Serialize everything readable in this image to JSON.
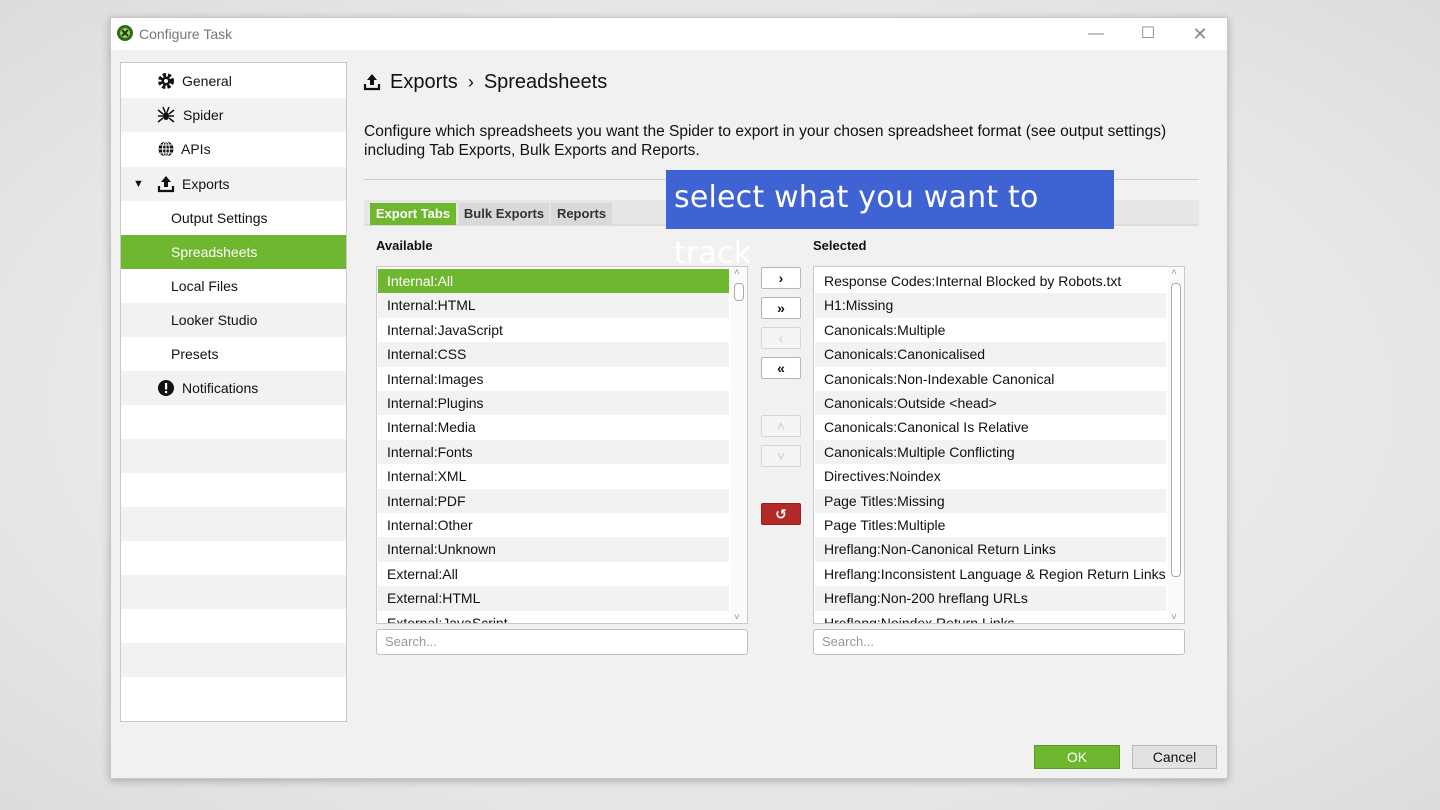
{
  "window": {
    "title": "Configure Task",
    "minimize": "—",
    "maximize": "☐",
    "close": "✕"
  },
  "sidebar": {
    "items": [
      {
        "label": "General",
        "icon": "gear-icon"
      },
      {
        "label": "Spider",
        "icon": "spider-icon"
      },
      {
        "label": "APIs",
        "icon": "globe-icon"
      },
      {
        "label": "Exports",
        "icon": "upload-icon",
        "expand": "▼"
      },
      {
        "label": "Output Settings"
      },
      {
        "label": "Spreadsheets"
      },
      {
        "label": "Local Files"
      },
      {
        "label": "Looker Studio"
      },
      {
        "label": "Presets"
      },
      {
        "label": "Notifications",
        "icon": "alert-icon"
      }
    ]
  },
  "breadcrumb": {
    "part1": "Exports",
    "separator": "›",
    "part2": "Spreadsheets"
  },
  "description": "Configure which spreadsheets you want the Spider to export in your chosen spreadsheet format (see output settings) including Tab Exports, Bulk Exports and Reports.",
  "tabs": [
    "Export Tabs",
    "Bulk Exports",
    "Reports"
  ],
  "available": {
    "label": "Available",
    "items": [
      "Internal:All",
      "Internal:HTML",
      "Internal:JavaScript",
      "Internal:CSS",
      "Internal:Images",
      "Internal:Plugins",
      "Internal:Media",
      "Internal:Fonts",
      "Internal:XML",
      "Internal:PDF",
      "Internal:Other",
      "Internal:Unknown",
      "External:All",
      "External:HTML",
      "External:JavaScript"
    ],
    "search_placeholder": "Search..."
  },
  "selected": {
    "label": "Selected",
    "items": [
      "Response Codes:Internal Blocked by Robots.txt",
      "H1:Missing",
      "Canonicals:Multiple",
      "Canonicals:Canonicalised",
      "Canonicals:Non-Indexable Canonical",
      "Canonicals:Outside <head>",
      "Canonicals:Canonical Is Relative",
      "Canonicals:Multiple Conflicting",
      "Directives:Noindex",
      "Page Titles:Missing",
      "Page Titles:Multiple",
      "Hreflang:Non-Canonical Return Links",
      "Hreflang:Inconsistent Language & Region Return Links",
      "Hreflang:Non-200 hreflang URLs",
      "Hreflang:Noindex Return Links"
    ],
    "search_placeholder": "Search..."
  },
  "move_buttons": {
    "add": "›",
    "add_all": "»",
    "remove": "‹",
    "remove_all": "«",
    "up": "˄",
    "down": "˅",
    "reset": "↺"
  },
  "footer": {
    "ok": "OK",
    "cancel": "Cancel"
  },
  "overlay_caption": "select what you want to track",
  "colors": {
    "accent_green": "#6fb72e",
    "overlay_blue": "#3f63d3",
    "reset_red": "#b22a2a"
  }
}
